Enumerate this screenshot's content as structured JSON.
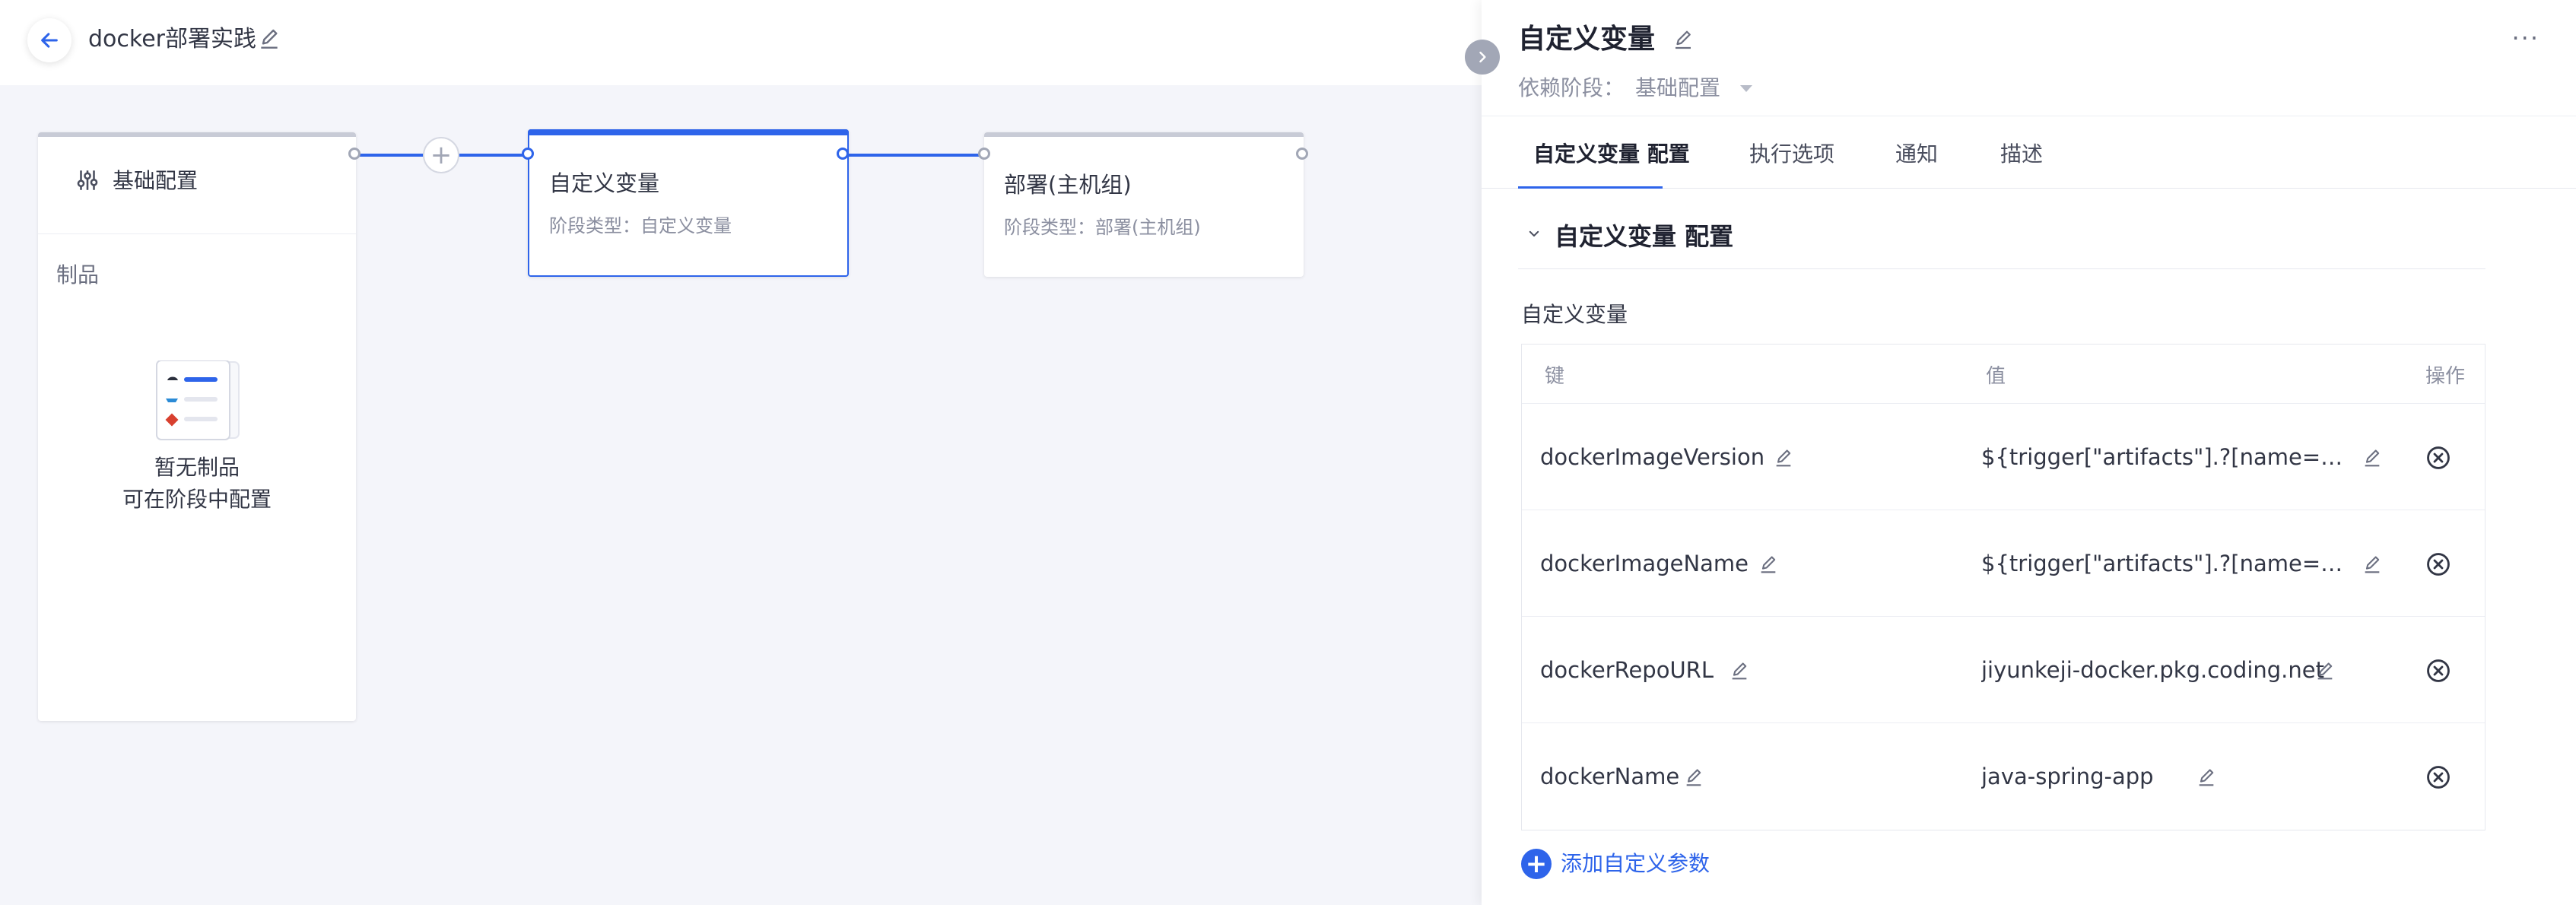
{
  "header": {
    "title": "docker部署实践"
  },
  "pipeline": {
    "base_stage": {
      "title": "基础配置",
      "artifacts_label": "制品",
      "empty_line1": "暂无制品",
      "empty_line2": "可在阶段中配置"
    },
    "stages": [
      {
        "title": "自定义变量",
        "subtitle": "阶段类型：自定义变量",
        "selected": true
      },
      {
        "title": "部署(主机组)",
        "subtitle": "阶段类型：部署(主机组)",
        "selected": false
      }
    ],
    "add_symbol": "+"
  },
  "panel": {
    "title": "自定义变量",
    "more": "···",
    "dependency_label": "依赖阶段：",
    "dependency_value": "基础配置",
    "tabs": [
      {
        "label": "自定义变量 配置",
        "active": true
      },
      {
        "label": "执行选项",
        "active": false
      },
      {
        "label": "通知",
        "active": false
      },
      {
        "label": "描述",
        "active": false
      }
    ],
    "section_title": "自定义变量 配置",
    "field_label": "自定义变量",
    "table": {
      "headers": {
        "key": "键",
        "value": "值",
        "action": "操作"
      },
      "rows": [
        {
          "key": "dockerImageVersion",
          "value": "${trigger[\"artifacts\"].?[name==\"jiy..."
        },
        {
          "key": "dockerImageName",
          "value": "${trigger[\"artifacts\"].?[name==\"jiy..."
        },
        {
          "key": "dockerRepoURL",
          "value": "jiyunkeji-docker.pkg.coding.net"
        },
        {
          "key": "dockerName",
          "value": "java-spring-app"
        }
      ]
    },
    "add_param_label": "添加自定义参数"
  },
  "colors": {
    "accent": "#2e64ea",
    "muted": "#8b8fa0",
    "text": "#323645",
    "canvas_bg": "#f4f5fa"
  },
  "icons": [
    "arrow-left-icon",
    "pencil-icon",
    "sliders-icon",
    "chevron-right-icon",
    "chevron-down-icon",
    "close-circle-icon",
    "plus-circle-icon",
    "empty-artifacts-illustration"
  ]
}
